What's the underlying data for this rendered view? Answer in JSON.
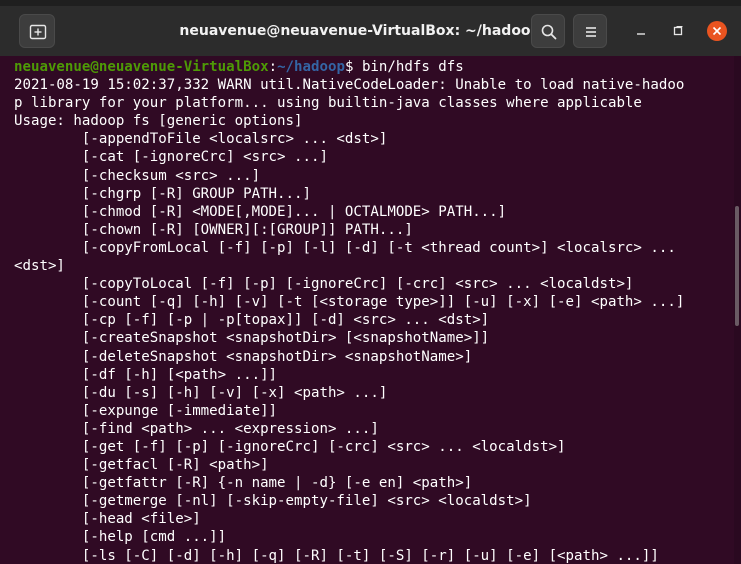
{
  "window": {
    "title": "neuavenue@neuavenue-VirtualBox: ~/hadoop"
  },
  "icons": {
    "new_tab": "new-tab-icon",
    "search": "search-icon",
    "menu": "hamburger-menu-icon",
    "minimize": "minimize-icon",
    "maximize": "maximize-icon",
    "close": "close-icon"
  },
  "colors": {
    "terminal_bg": "#300a24",
    "titlebar_bg": "#2c2c2c",
    "prompt_user": "#4e9a06",
    "prompt_path": "#3465a4",
    "close_button": "#e95420"
  },
  "terminal": {
    "prompt": {
      "user_host": "neuavenue@neuavenue-VirtualBox",
      "separator": ":",
      "path": "~/hadoop",
      "symbol": "$ ",
      "command": "bin/hdfs dfs"
    },
    "output": [
      "2021-08-19 15:02:37,332 WARN util.NativeCodeLoader: Unable to load native-hadoo",
      "p library for your platform... using builtin-java classes where applicable",
      "Usage: hadoop fs [generic options]",
      "        [-appendToFile <localsrc> ... <dst>]",
      "        [-cat [-ignoreCrc] <src> ...]",
      "        [-checksum <src> ...]",
      "        [-chgrp [-R] GROUP PATH...]",
      "        [-chmod [-R] <MODE[,MODE]... | OCTALMODE> PATH...]",
      "        [-chown [-R] [OWNER][:[GROUP]] PATH...]",
      "        [-copyFromLocal [-f] [-p] [-l] [-d] [-t <thread count>] <localsrc> ...",
      "<dst>]",
      "        [-copyToLocal [-f] [-p] [-ignoreCrc] [-crc] <src> ... <localdst>]",
      "        [-count [-q] [-h] [-v] [-t [<storage type>]] [-u] [-x] [-e] <path> ...]",
      "        [-cp [-f] [-p | -p[topax]] [-d] <src> ... <dst>]",
      "        [-createSnapshot <snapshotDir> [<snapshotName>]]",
      "        [-deleteSnapshot <snapshotDir> <snapshotName>]",
      "        [-df [-h] [<path> ...]]",
      "        [-du [-s] [-h] [-v] [-x] <path> ...]",
      "        [-expunge [-immediate]]",
      "        [-find <path> ... <expression> ...]",
      "        [-get [-f] [-p] [-ignoreCrc] [-crc] <src> ... <localdst>]",
      "        [-getfacl [-R] <path>]",
      "        [-getfattr [-R] {-n name | -d} [-e en] <path>]",
      "        [-getmerge [-nl] [-skip-empty-file] <src> <localdst>]",
      "        [-head <file>]",
      "        [-help [cmd ...]]",
      "        [-ls [-C] [-d] [-h] [-q] [-R] [-t] [-S] [-r] [-u] [-e] [<path> ...]]"
    ]
  }
}
